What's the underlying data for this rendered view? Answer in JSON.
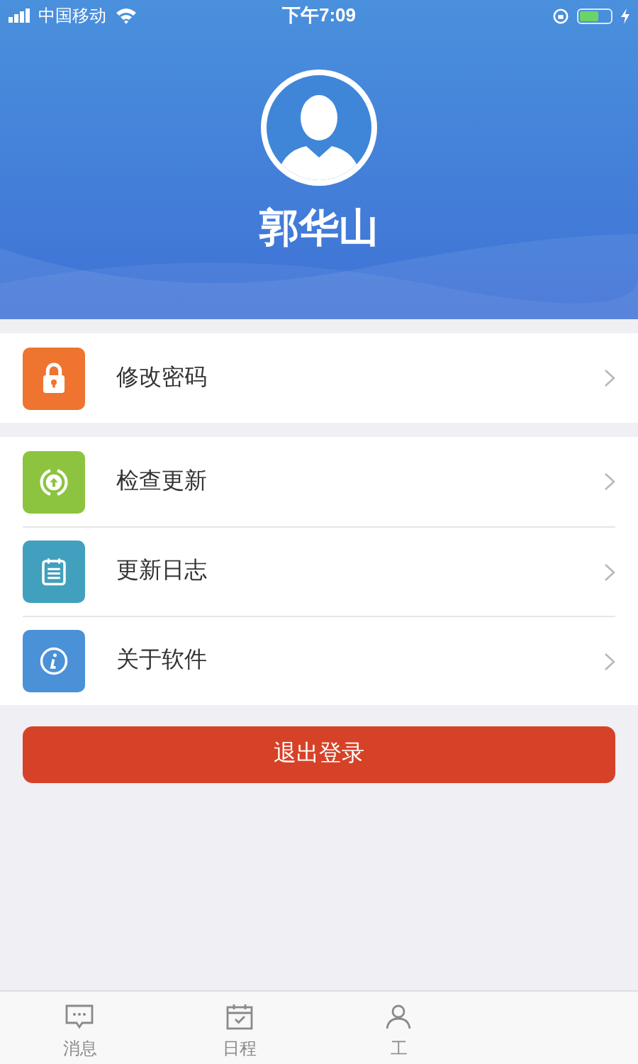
{
  "status_bar": {
    "carrier": "中国移动",
    "time": "下午7:09"
  },
  "profile": {
    "name": "郭华山"
  },
  "sections": [
    {
      "items": [
        {
          "label": "修改密码",
          "kind": "lock",
          "color": "#ee7430"
        }
      ]
    },
    {
      "items": [
        {
          "label": "检查更新",
          "kind": "update",
          "color": "#8cc43f"
        },
        {
          "label": "更新日志",
          "kind": "log",
          "color": "#41a0bd"
        },
        {
          "label": "关于软件",
          "kind": "info",
          "color": "#4b91d8"
        }
      ]
    }
  ],
  "logout_button": "退出登录",
  "tab_bar": [
    {
      "label": "消息",
      "kind": "message"
    },
    {
      "label": "日程",
      "kind": "calendar"
    },
    {
      "label": "工",
      "kind": "work"
    }
  ]
}
